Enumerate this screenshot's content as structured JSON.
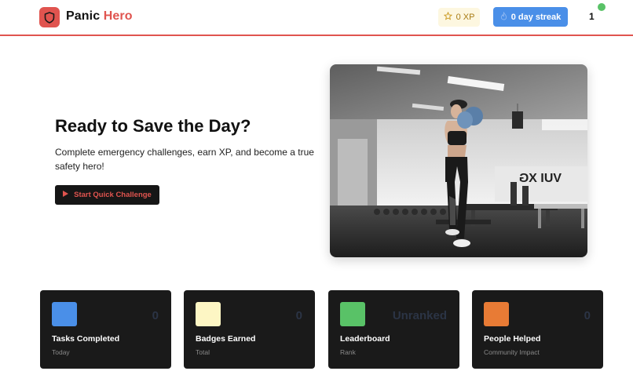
{
  "header": {
    "brand_part1": "Panic",
    "brand_part2": "Hero",
    "xp_label": "0 XP",
    "streak_label": "0 day streak",
    "level": "1",
    "colors": {
      "accent": "#e0544f",
      "streak": "#4a8fe8",
      "online": "#59c267"
    },
    "icons": {
      "logo": "shield-icon",
      "xp": "star-icon",
      "streak": "flame-icon"
    }
  },
  "hero": {
    "title": "Ready to Save the Day?",
    "subtitle": "Complete emergency challenges, earn XP, and become a true safety hero!",
    "cta_label": "Start Quick Challenge",
    "cta_icon": "play-icon",
    "image_alt": "Boxer training in a gym"
  },
  "stats": [
    {
      "title": "Tasks Completed",
      "caption": "Today",
      "value": "0",
      "color": "#4a8fe8"
    },
    {
      "title": "Badges Earned",
      "caption": "Total",
      "value": "0",
      "color": "#fdf6c4"
    },
    {
      "title": "Leaderboard",
      "caption": "Rank",
      "value": "Unranked",
      "color": "#59c267"
    },
    {
      "title": "People Helped",
      "caption": "Community Impact",
      "value": "0",
      "color": "#e87b35"
    }
  ]
}
